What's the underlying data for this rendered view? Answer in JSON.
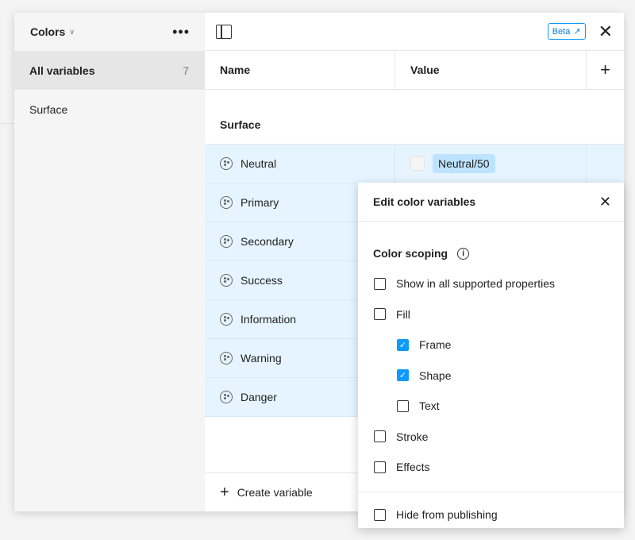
{
  "sidebar": {
    "title": "Colors",
    "items": [
      {
        "label": "All variables",
        "count": "7"
      },
      {
        "label": "Surface"
      }
    ]
  },
  "topbar": {
    "beta": "Beta"
  },
  "table": {
    "headers": {
      "name": "Name",
      "value": "Value"
    },
    "group": "Surface",
    "rows": [
      {
        "name": "Neutral",
        "value": "Neutral/50"
      },
      {
        "name": "Primary"
      },
      {
        "name": "Secondary"
      },
      {
        "name": "Success"
      },
      {
        "name": "Information"
      },
      {
        "name": "Warning"
      },
      {
        "name": "Danger"
      }
    ]
  },
  "footer": {
    "create": "Create variable"
  },
  "popup": {
    "title": "Edit color variables",
    "scoping": "Color scoping",
    "options": [
      {
        "label": "Show in all supported properties",
        "checked": false
      },
      {
        "label": "Fill",
        "checked": false
      },
      {
        "label": "Frame",
        "checked": true
      },
      {
        "label": "Shape",
        "checked": true
      },
      {
        "label": "Text",
        "checked": false
      },
      {
        "label": "Stroke",
        "checked": false
      },
      {
        "label": "Effects",
        "checked": false
      }
    ],
    "hide": {
      "label": "Hide from publishing",
      "checked": false
    }
  },
  "colors": {
    "accent": "#0d99ff",
    "row_selected": "#e5f4ff",
    "pill": "#bde3ff"
  }
}
